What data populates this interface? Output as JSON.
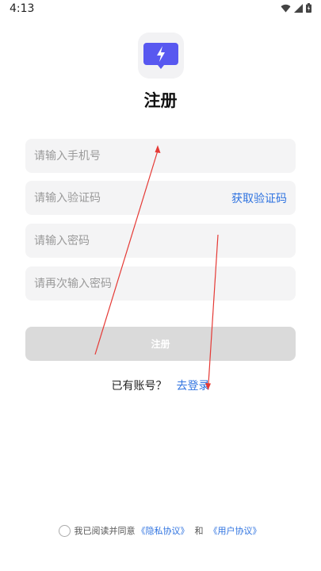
{
  "status_bar": {
    "time": "4:13"
  },
  "page": {
    "title": "注册"
  },
  "form": {
    "phone_placeholder": "请输入手机号",
    "code_placeholder": "请输入验证码",
    "get_code_label": "获取验证码",
    "password_placeholder": "请输入密码",
    "confirm_placeholder": "请再次输入密码",
    "register_label": "注册"
  },
  "login": {
    "prompt": "已有账号？",
    "link": "去登录"
  },
  "agreement": {
    "text": "我已阅读并同意",
    "privacy": "《隐私协议》",
    "and": "和",
    "user": "《用户协议》"
  },
  "colors": {
    "accent": "#2f73e0",
    "logo": "#5858f0",
    "annotation": "#e53935"
  }
}
